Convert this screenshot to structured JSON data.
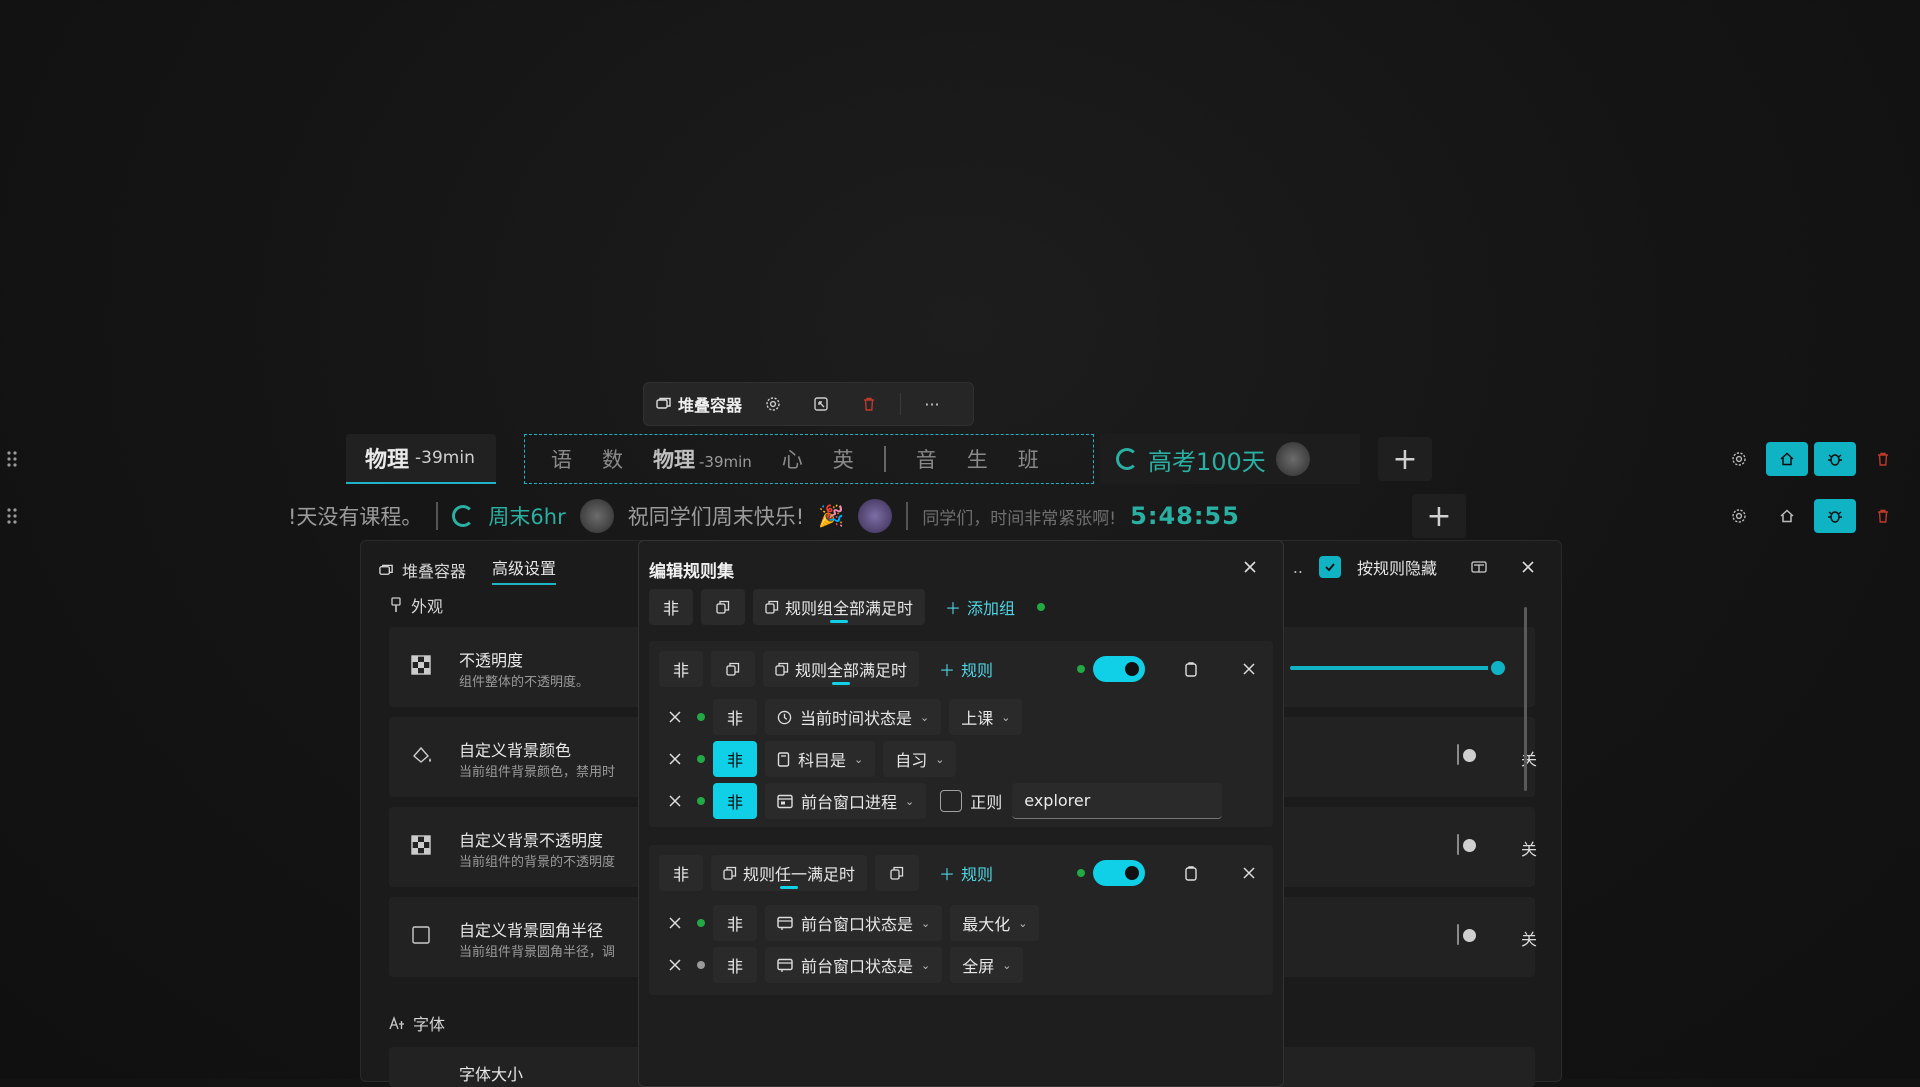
{
  "float_toolbar": {
    "title": "堆叠容器",
    "more": "···"
  },
  "row1": {
    "subject": {
      "name": "物理",
      "time": "-39min"
    },
    "courses": [
      "语",
      "数",
      "物理",
      "心",
      "英",
      "音",
      "生",
      "班"
    ],
    "current_time": "-39min",
    "countdown": "高考100天",
    "plus": "+"
  },
  "row2": {
    "text1": "!天没有课程。",
    "weekend": "周末6hr",
    "greeting": "祝同学们周末快乐!",
    "notice": "同学们，时间非常紧张啊!",
    "clock": "5:48:55",
    "plus": "+"
  },
  "settings": {
    "tab1": "堆叠容器",
    "tab2": "高级设置",
    "appearance": "外观",
    "hide_by_rule": "按规则隐藏",
    "font_section": "字体",
    "items": [
      {
        "title": "不透明度",
        "subtitle": "组件整体的不透明度。"
      },
      {
        "title": "自定义背景颜色",
        "subtitle": "当前组件背景颜色，禁用时",
        "toggle": "关"
      },
      {
        "title": "自定义背景不透明度",
        "subtitle": "当前组件的背景的不透明度",
        "toggle": "关"
      },
      {
        "title": "自定义背景圆角半径",
        "subtitle": "当前组件背景圆角半径，调",
        "toggle": "关"
      },
      {
        "title": "字体大小"
      }
    ],
    "ellipsis": ".."
  },
  "dialog": {
    "title": "编辑规则集",
    "not": "非",
    "mode_all_groups": "规则组全部满足时",
    "add_group": "添加组",
    "group1": {
      "mode": "规则全部满足时",
      "add_rule": "规则",
      "rules": [
        {
          "field": "当前时间状态是",
          "value": "上课"
        },
        {
          "field": "科目是",
          "value": "自习"
        },
        {
          "field": "前台窗口进程",
          "regex_label": "正则",
          "value": "explorer"
        }
      ]
    },
    "group2": {
      "mode": "规则任一满足时",
      "add_rule": "规则",
      "rules": [
        {
          "field": "前台窗口状态是",
          "value": "最大化"
        },
        {
          "field": "前台窗口状态是",
          "value": "全屏"
        }
      ]
    }
  },
  "colors": {
    "accent": "#0fd0e6",
    "green_dot": "#22a845",
    "delete": "#c0392b"
  }
}
